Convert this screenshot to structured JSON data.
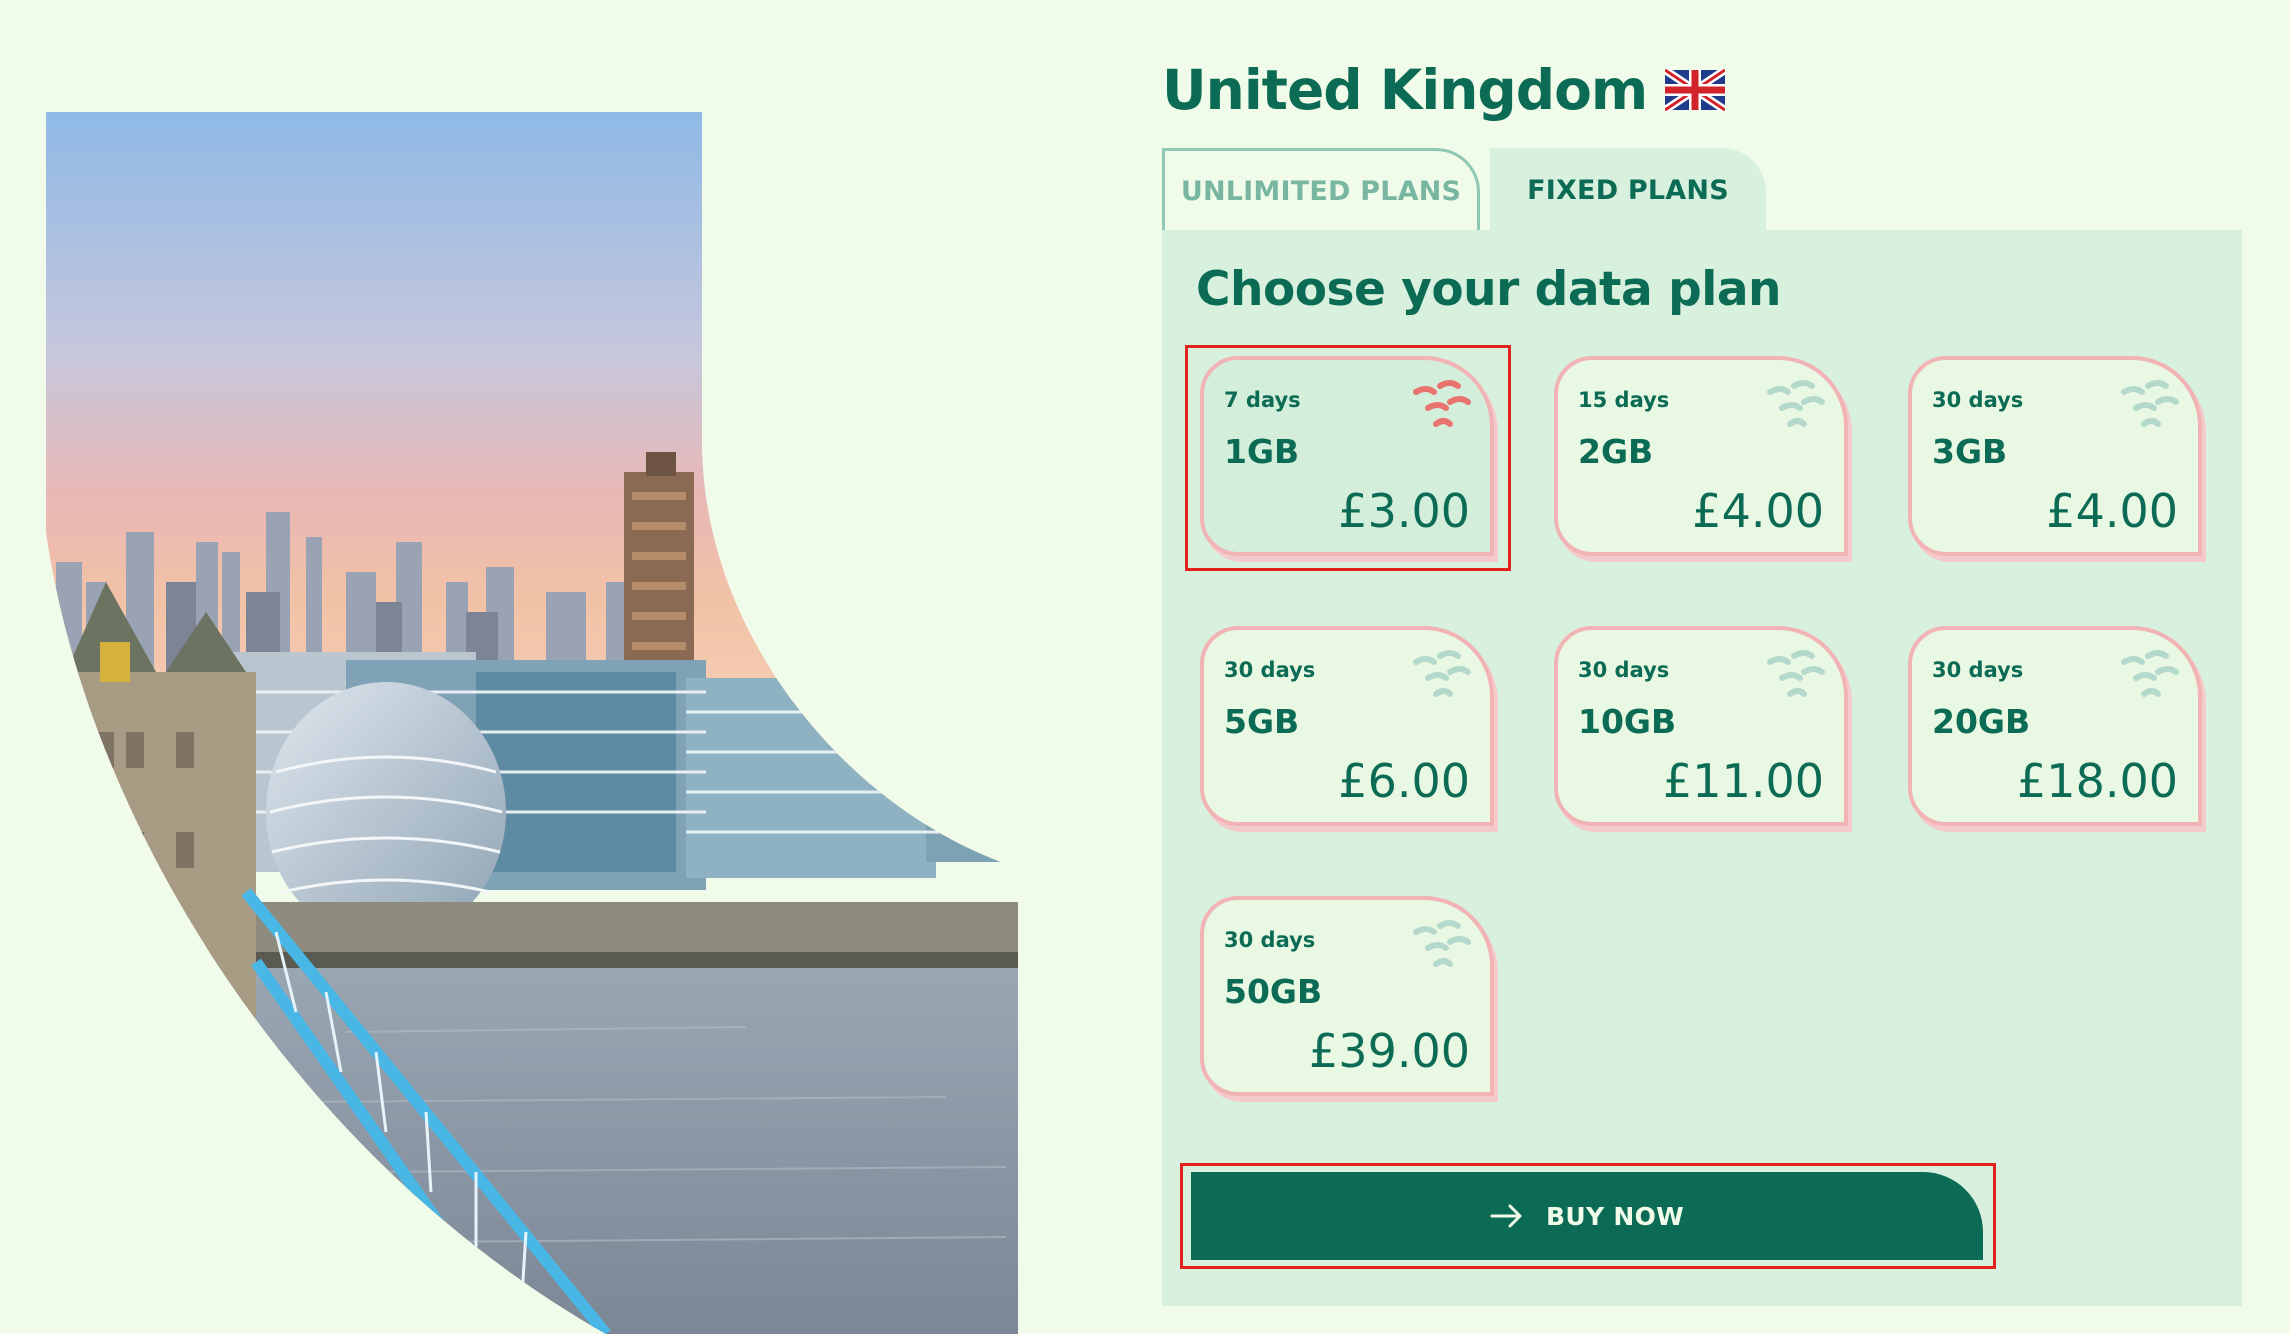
{
  "country": {
    "title": "United Kingdom",
    "flag_icon": "uk-flag-icon"
  },
  "tabs": [
    {
      "label": "UNLIMITED PLANS",
      "active": false
    },
    {
      "label": "FIXED PLANS",
      "active": true
    }
  ],
  "plans_heading": "Choose your data plan",
  "plans": [
    {
      "days": "7 days",
      "size": "1GB",
      "price": "£3.00",
      "selected": true
    },
    {
      "days": "15 days",
      "size": "2GB",
      "price": "£4.00",
      "selected": false
    },
    {
      "days": "30 days",
      "size": "3GB",
      "price": "£4.00",
      "selected": false
    },
    {
      "days": "30 days",
      "size": "5GB",
      "price": "£6.00",
      "selected": false
    },
    {
      "days": "30 days",
      "size": "10GB",
      "price": "£11.00",
      "selected": false
    },
    {
      "days": "30 days",
      "size": "20GB",
      "price": "£18.00",
      "selected": false
    },
    {
      "days": "30 days",
      "size": "50GB",
      "price": "£39.00",
      "selected": false
    }
  ],
  "buy_button": {
    "label": "BUY NOW",
    "icon": "arrow-right-icon"
  },
  "colors": {
    "background": "#f0fbe9",
    "brand_green": "#0b6b54",
    "panel": "#d8f0de",
    "card_border": "#f1b3b3",
    "selected_icon": "#e8736f",
    "idle_icon": "#b5d8cd",
    "highlight": "#e0241b"
  }
}
